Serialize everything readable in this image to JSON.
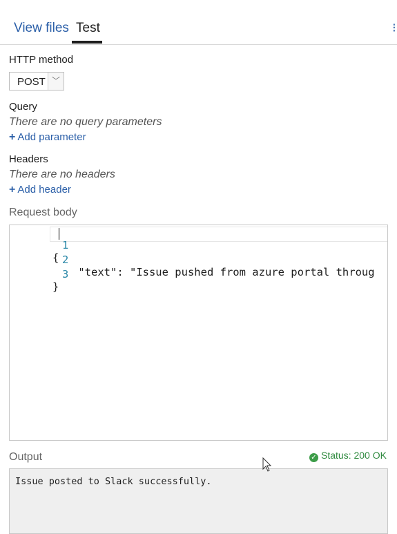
{
  "tabs": [
    {
      "label": "View files",
      "active": false
    },
    {
      "label": "Test",
      "active": true
    }
  ],
  "icons": {
    "expand": "expand-icon",
    "add": "plus-icon",
    "dropdown": "chevron-down-icon",
    "status": "check-circle-icon",
    "cursor": "mouse-pointer-icon"
  },
  "http_method": {
    "label": "HTTP method",
    "value": "POST"
  },
  "query": {
    "label": "Query",
    "empty_text": "There are no query parameters",
    "add_label": "Add parameter"
  },
  "headers": {
    "label": "Headers",
    "empty_text": "There are no headers",
    "add_label": "Add header"
  },
  "request_body": {
    "label": "Request body",
    "lines": [
      {
        "num": "1",
        "text": "{"
      },
      {
        "num": "2",
        "text": "    \"text\": \"Issue pushed from azure portal throug"
      },
      {
        "num": "3",
        "text": "}"
      }
    ]
  },
  "output": {
    "label": "Output",
    "status_text": "Status: 200 OK",
    "status_color": "#2f8a3f",
    "text": "Issue posted to Slack successfully."
  },
  "colors": {
    "accent": "#2b5fa8",
    "line_number": "#2b88a8"
  }
}
